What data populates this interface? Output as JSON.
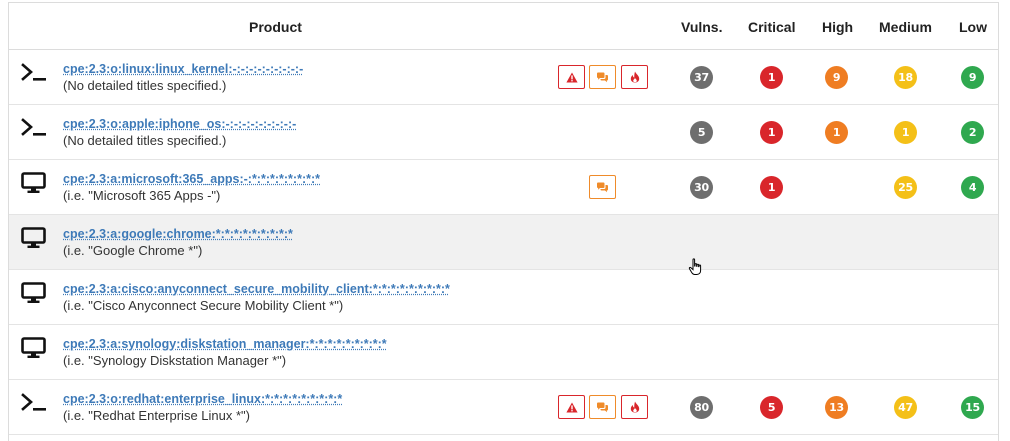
{
  "colors": {
    "total": "#6e6e6e",
    "critical": "#d9262b",
    "high": "#ef7d22",
    "medium": "#f4c018",
    "low": "#2fa84f",
    "link": "#3e7ab8"
  },
  "header": {
    "product": "Product",
    "vulns": "Vulns.",
    "critical": "Critical",
    "high": "High",
    "medium": "Medium",
    "low": "Low"
  },
  "rows": [
    {
      "icon": "terminal-icon",
      "title": "cpe:2.3:o:linux:linux_kernel:-:-:-:-:-:-:-:-:-",
      "subtitle": "(No detailed titles specified.)",
      "flags": [
        "warning",
        "comments",
        "fire"
      ],
      "vulns": "37",
      "critical": "1",
      "high": "9",
      "medium": "18",
      "low": "9"
    },
    {
      "icon": "terminal-icon",
      "title": "cpe:2.3:o:apple:iphone_os:-:-:-:-:-:-:-:-:-",
      "subtitle": "(No detailed titles specified.)",
      "flags": [],
      "vulns": "5",
      "critical": "1",
      "high": "1",
      "medium": "1",
      "low": "2"
    },
    {
      "icon": "monitor-icon",
      "title": "cpe:2.3:a:microsoft:365_apps:-:*:*:*:*:*:*:*:*",
      "subtitle": "(i.e. \"Microsoft 365 Apps -\")",
      "flags": [
        "comments"
      ],
      "vulns": "30",
      "critical": "1",
      "high": "",
      "medium": "25",
      "low": "4"
    },
    {
      "icon": "monitor-icon",
      "title": "cpe:2.3:a:google:chrome:*:*:*:*:*:*:*:*:*",
      "subtitle": "(i.e. \"Google Chrome *\")",
      "flags": [],
      "vulns": "",
      "critical": "",
      "high": "",
      "medium": "",
      "low": ""
    },
    {
      "icon": "monitor-icon",
      "title": "cpe:2.3:a:cisco:anyconnect_secure_mobility_client:*:*:*:*:*:*:*:*:*",
      "subtitle": "(i.e. \"Cisco Anyconnect Secure Mobility Client *\")",
      "flags": [],
      "vulns": "",
      "critical": "",
      "high": "",
      "medium": "",
      "low": ""
    },
    {
      "icon": "monitor-icon",
      "title": "cpe:2.3:a:synology:diskstation_manager:*:*:*:*:*:*:*:*:*",
      "subtitle": "(i.e. \"Synology Diskstation Manager *\")",
      "flags": [],
      "vulns": "",
      "critical": "",
      "high": "",
      "medium": "",
      "low": ""
    },
    {
      "icon": "terminal-icon",
      "title": "cpe:2.3:o:redhat:enterprise_linux:*:*:*:*:*:*:*:*:*",
      "subtitle": "(i.e. \"Redhat Enterprise Linux *\")",
      "flags": [
        "warning",
        "comments",
        "fire"
      ],
      "vulns": "80",
      "critical": "5",
      "high": "13",
      "medium": "47",
      "low": "15"
    }
  ]
}
